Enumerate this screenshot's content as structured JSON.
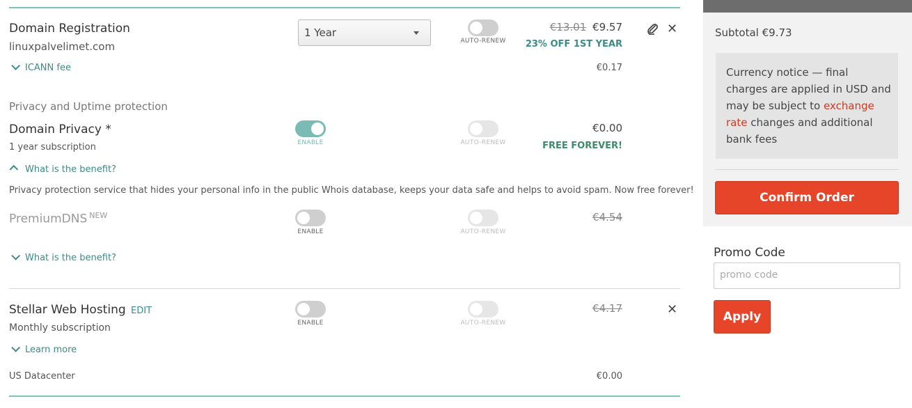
{
  "domain": {
    "title": "Domain Registration",
    "name": "linuxpalvelimet.com",
    "period_select": "1 Year",
    "auto_renew_label": "AUTO-RENEW",
    "old_price": "€13.01",
    "price": "€9.57",
    "discount": "23% OFF 1ST YEAR",
    "icann_label": "ICANN fee",
    "icann_price": "€0.17"
  },
  "privacy_section": {
    "heading": "Privacy and Uptime protection",
    "title": "Domain Privacy *",
    "sub": "1 year subscription",
    "enable_label": "ENABLE",
    "auto_renew_label": "AUTO-RENEW",
    "price": "€0.00",
    "free": "FREE FOREVER!",
    "benefit_label": "What is the benefit?",
    "description": "Privacy protection service that hides your personal info in the public Whois database, keeps your data safe and helps to avoid spam. Now free forever!"
  },
  "premium_dns": {
    "title": "PremiumDNS",
    "badge": "NEW",
    "enable_label": "ENABLE",
    "auto_renew_label": "AUTO-RENEW",
    "old_price": "€4.54",
    "benefit_label": "What is the benefit?"
  },
  "hosting": {
    "title": "Stellar Web Hosting",
    "edit": "EDIT",
    "sub": "Monthly subscription",
    "enable_label": "ENABLE",
    "auto_renew_label": "AUTO-RENEW",
    "old_price": "€4.17",
    "learn_more": "Learn more",
    "datacenter": "US Datacenter",
    "datacenter_price": "€0.00"
  },
  "summary": {
    "subtotal": "Subtotal €9.73",
    "notice_part1": "Currency notice — final charges are applied in USD and may be subject to ",
    "notice_link": "exchange rate",
    "notice_part2": " changes and additional bank fees",
    "confirm": "Confirm Order"
  },
  "promo": {
    "heading": "Promo Code",
    "placeholder": "promo code",
    "apply": "Apply"
  },
  "colors": {
    "accent": "#e7452a",
    "teal": "#7cc2bd",
    "link_teal": "#3a8c88"
  }
}
